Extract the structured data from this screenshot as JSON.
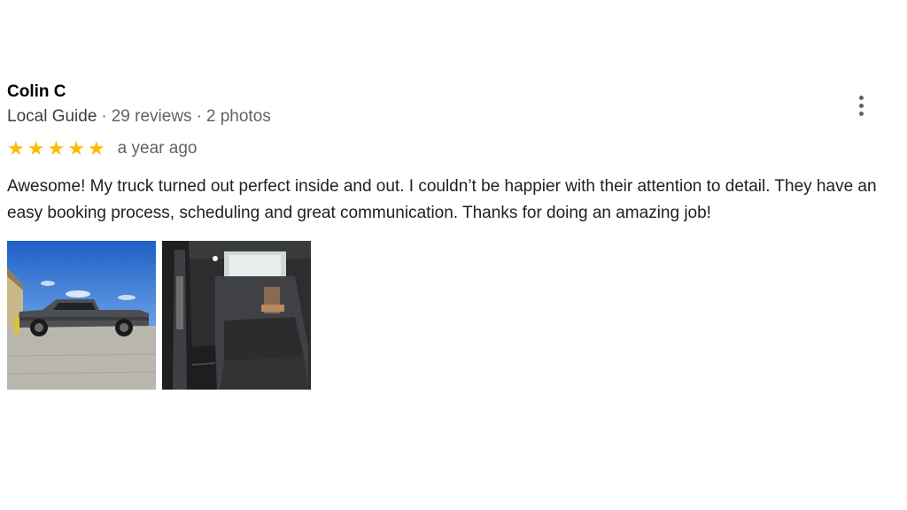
{
  "review": {
    "author": "Colin C",
    "badge": "Local Guide",
    "reviews_count": "29 reviews",
    "photos_count": "2 photos",
    "separator": "·",
    "rating": 5,
    "star_color": "#fbbc04",
    "time": "a year ago",
    "text": "Awesome! My truck turned out perfect inside and out. I couldn’t be happier with their attention to detail. They have an easy booking process, scheduling and great communication. Thanks for doing an amazing job!",
    "photos": [
      {
        "name": "truck-exterior-photo"
      },
      {
        "name": "truck-interior-photo"
      }
    ]
  },
  "actions": {
    "more_icon": "more-vert-icon"
  }
}
